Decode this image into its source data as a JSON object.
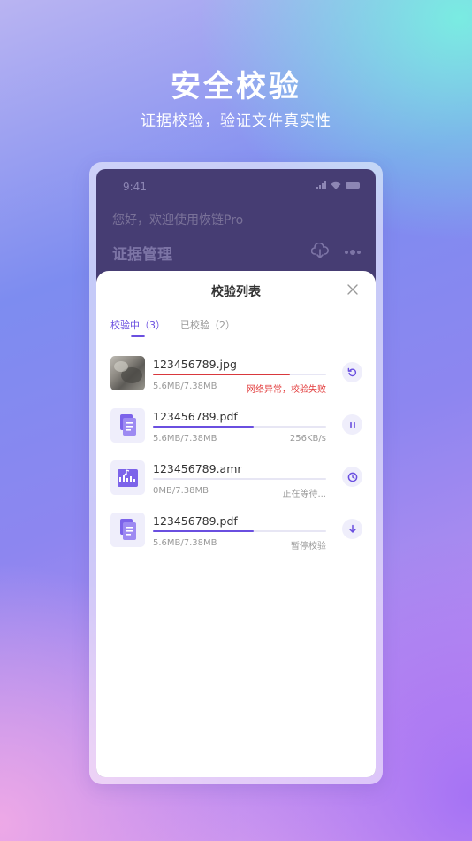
{
  "promo": {
    "title": "安全校验",
    "subtitle": "证据校验，验证文件真实性"
  },
  "status_bar": {
    "time": "9:41"
  },
  "app": {
    "greeting": "您好，欢迎使用恢链Pro",
    "title": "证据管理"
  },
  "sheet": {
    "title": "校验列表",
    "tabs": [
      {
        "label": "校验中（3）",
        "active": true
      },
      {
        "label": "已校验（2）",
        "active": false
      }
    ],
    "files": [
      {
        "name": "123456789.jpg",
        "size": "5.6MB/7.38MB",
        "status": "网络异常，校验失败",
        "progress": 0.79,
        "progress_color": "#d9383d",
        "type": "image",
        "action": "retry"
      },
      {
        "name": "123456789.pdf",
        "size": "5.6MB/7.38MB",
        "status": "256KB/s",
        "progress": 0.58,
        "progress_color": "#6a4fe0",
        "type": "document",
        "action": "pause"
      },
      {
        "name": "123456789.amr",
        "size": "0MB/7.38MB",
        "status": "正在等待...",
        "progress": 0,
        "progress_color": "#6a4fe0",
        "type": "audio",
        "action": "waiting"
      },
      {
        "name": "123456789.pdf",
        "size": "5.6MB/7.38MB",
        "status": "暂停校验",
        "progress": 0.58,
        "progress_color": "#6a4fe0",
        "type": "document",
        "action": "resume"
      }
    ]
  },
  "colors": {
    "accent": "#6a4fe0",
    "error": "#e23b3b"
  }
}
